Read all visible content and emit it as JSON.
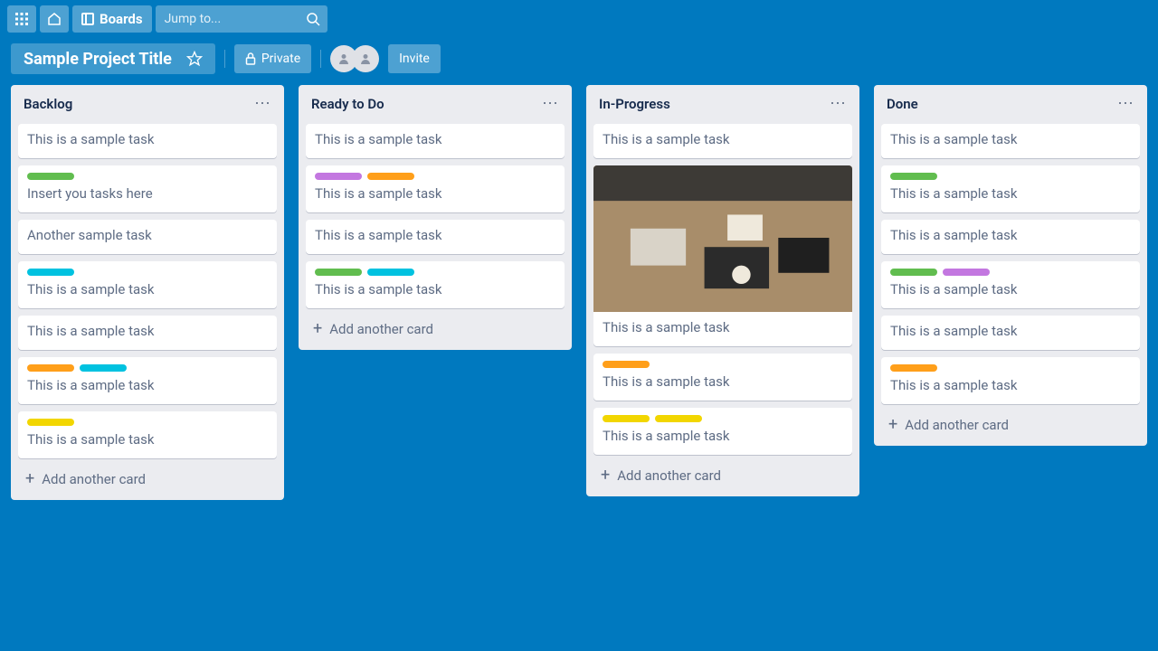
{
  "topbar": {
    "boards_label": "Boards",
    "search_placeholder": "Jump to..."
  },
  "boardbar": {
    "title": "Sample Project Title",
    "private_label": "Private",
    "invite_label": "Invite"
  },
  "lists": [
    {
      "title": "Backlog",
      "cards": [
        {
          "labels": [],
          "text": "This is a sample task"
        },
        {
          "labels": [
            "green"
          ],
          "text": "Insert you tasks here"
        },
        {
          "labels": [],
          "text": "Another sample task"
        },
        {
          "labels": [
            "blue"
          ],
          "text": "This is a sample task"
        },
        {
          "labels": [],
          "text": "This is a sample task"
        },
        {
          "labels": [
            "orange",
            "blue"
          ],
          "text": "This is a sample task"
        },
        {
          "labels": [
            "yellow"
          ],
          "text": "This is a sample task"
        }
      ]
    },
    {
      "title": "Ready to Do",
      "cards": [
        {
          "labels": [],
          "text": "This is a sample task"
        },
        {
          "labels": [
            "purple",
            "orange"
          ],
          "text": "This is a sample task"
        },
        {
          "labels": [],
          "text": "This is a sample task"
        },
        {
          "labels": [
            "green",
            "blue"
          ],
          "text": "This is a sample task"
        }
      ]
    },
    {
      "title": "In-Progress",
      "cards": [
        {
          "labels": [],
          "text": "This is a sample task"
        },
        {
          "labels": [],
          "text": "This is a sample task",
          "cover": true
        },
        {
          "labels": [
            "orange"
          ],
          "text": "This is a sample task"
        },
        {
          "labels": [
            "yellow",
            "yellow"
          ],
          "text": "This is a sample task"
        }
      ]
    },
    {
      "title": "Done",
      "cards": [
        {
          "labels": [],
          "text": "This is a sample task"
        },
        {
          "labels": [
            "green"
          ],
          "text": "This is a sample task"
        },
        {
          "labels": [],
          "text": "This is a sample task"
        },
        {
          "labels": [
            "green",
            "purple"
          ],
          "text": "This is a sample task"
        },
        {
          "labels": [],
          "text": "This is a sample task"
        },
        {
          "labels": [
            "orange"
          ],
          "text": "This is a sample task"
        }
      ]
    }
  ],
  "add_card_label": "Add another card"
}
